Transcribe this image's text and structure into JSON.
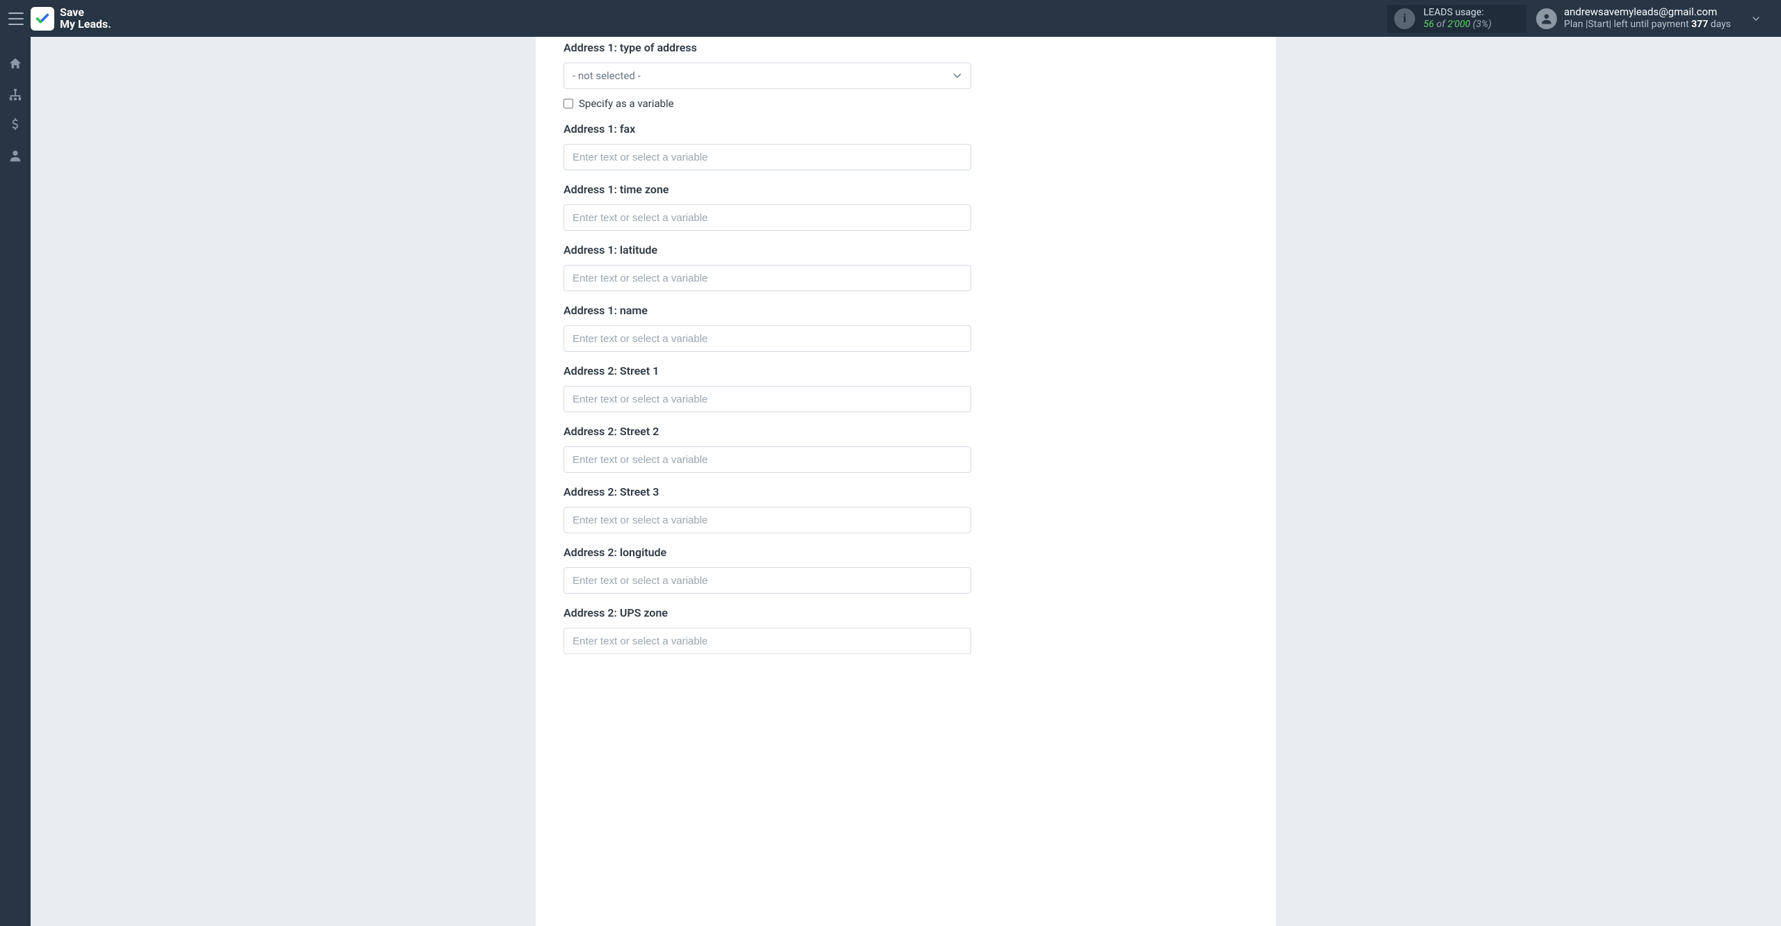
{
  "brand": {
    "line1": "Save",
    "line2": "My Leads."
  },
  "usage": {
    "title": "LEADS usage:",
    "used": "56",
    "of": "of",
    "limit": "2'000",
    "percent": "(3%)"
  },
  "account": {
    "email": "andrewsavemyleads@gmail.com",
    "plan_prefix": "Plan",
    "plan_name": "|Start|",
    "plan_mid": "left until payment",
    "plan_days_number": "377",
    "plan_days_word": "days"
  },
  "form": {
    "select_placeholder": "- not selected -",
    "specify_variable": "Specify as a variable",
    "input_placeholder": "Enter text or select a variable"
  },
  "fields": [
    {
      "label": "Address 1: type of address",
      "type": "select",
      "has_variable_checkbox": true
    },
    {
      "label": "Address 1: fax",
      "type": "text"
    },
    {
      "label": "Address 1: time zone",
      "type": "text"
    },
    {
      "label": "Address 1: latitude",
      "type": "text"
    },
    {
      "label": "Address 1: name",
      "type": "text"
    },
    {
      "label": "Address 2: Street 1",
      "type": "text"
    },
    {
      "label": "Address 2: Street 2",
      "type": "text"
    },
    {
      "label": "Address 2: Street 3",
      "type": "text"
    },
    {
      "label": "Address 2: longitude",
      "type": "text"
    },
    {
      "label": "Address 2: UPS zone",
      "type": "text"
    }
  ]
}
